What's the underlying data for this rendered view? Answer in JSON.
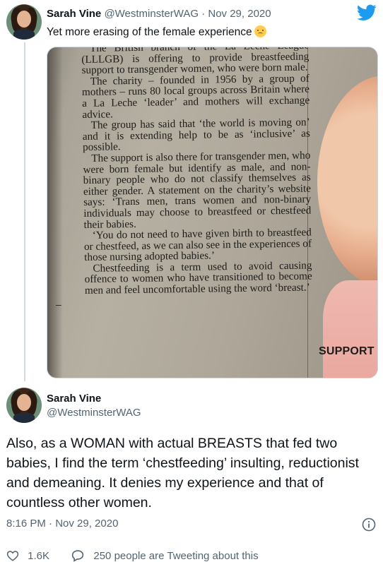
{
  "tweet": {
    "author_name": "Sarah Vine",
    "handle": "@WestminsterWAG",
    "separator": "·",
    "date": "Nov 29, 2020",
    "text": "Yet more erasing of the female experience",
    "emoji": "disappointed-face-emoji"
  },
  "newspaper_clip": {
    "paragraphs": [
      "The British branch of the La Leche League (LLLGB) is offering to provide breastfeeding support to transgender women, who were born male.",
      "The charity – founded in 1956 by a group of mothers – runs 80 local groups across Britain where a La Leche ‘leader’ and mothers will exchange advice.",
      "The group has said that ‘the world is moving on’ and it is extending help to be as ‘inclusive’ as possible.",
      "The support is also there for transgender men, who were born female but identify as male, and non-binary people who do not classify themselves as either gender. A statement on the charity’s website says: ‘Trans men, trans women and non-binary individuals may choose to breastfeed or chestfeed their babies.",
      "‘You do not need to have given birth to breastfeed or chestfeed, as we can also see in the experiences of those nursing adopted babies.’",
      "Chestfeeding is a term used to avoid causing offence to women who have transitioned to become men and feel uncomfortable using the word ‘breast.’"
    ],
    "side_label": "SUPPORT",
    "margin_mark": "–"
  },
  "reply": {
    "author_name": "Sarah Vine",
    "handle": "@WestminsterWAG",
    "text": "Also, as a WOMAN with actual BREASTS that fed two babies, I find the term ‘chestfeeding’ insulting, reductionist and demeaning. It denies my experience and that of countless other women.",
    "timestamp": "8:16 PM · Nov 29, 2020"
  },
  "actions": {
    "likes": "1.6K",
    "conversation": "250 people are Tweeting about this"
  },
  "colors": {
    "twitter_blue": "#1d9bf0",
    "muted_text": "#536471",
    "primary_text": "#0f1419"
  }
}
